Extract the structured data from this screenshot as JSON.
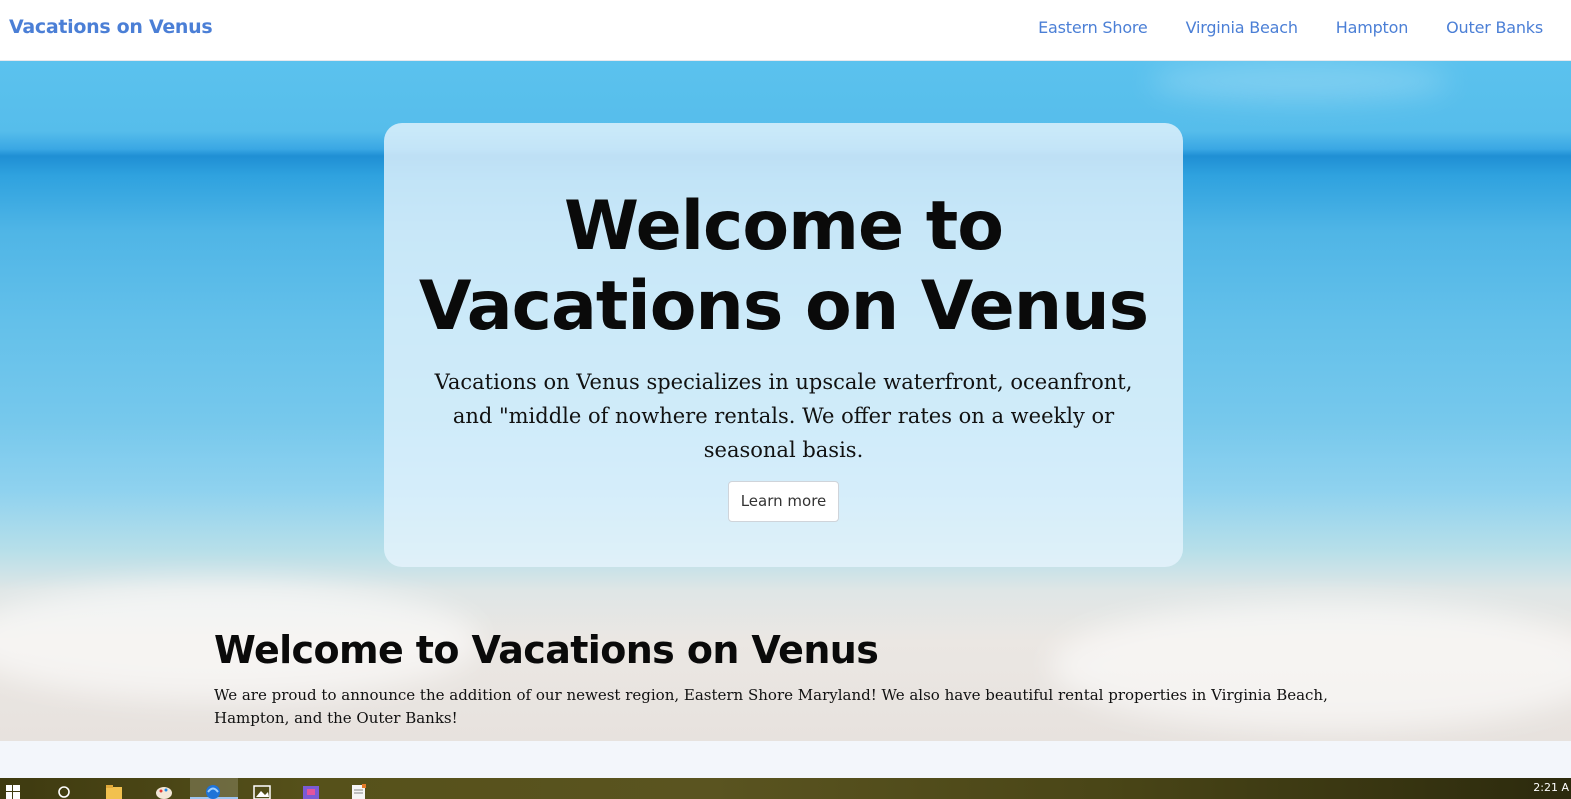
{
  "nav": {
    "brand": "Vacations on Venus",
    "links": [
      "Eastern Shore",
      "Virginia Beach",
      "Hampton",
      "Outer Banks"
    ]
  },
  "hero": {
    "title_line1": "Welcome to",
    "title_line2": "Vacations on Venus",
    "text": "Vacations on Venus specializes in upscale waterfront, oceanfront, and \"middle of nowhere rentals. We offer rates on a weekly or seasonal basis.",
    "button": "Learn more"
  },
  "section": {
    "title": "Welcome to Vacations on Venus",
    "text": "We are proud to announce the addition of our newest region, Eastern Shore Maryland! We also have beautiful rental properties in Virginia Beach, Hampton, and the Outer Banks!"
  },
  "taskbar": {
    "clock": "2:21 A",
    "icons": [
      "windows-start-icon",
      "search-icon",
      "file-explorer-icon",
      "paint-icon",
      "browser-icon",
      "photos-icon",
      "store-icon",
      "notepad-icon"
    ]
  }
}
